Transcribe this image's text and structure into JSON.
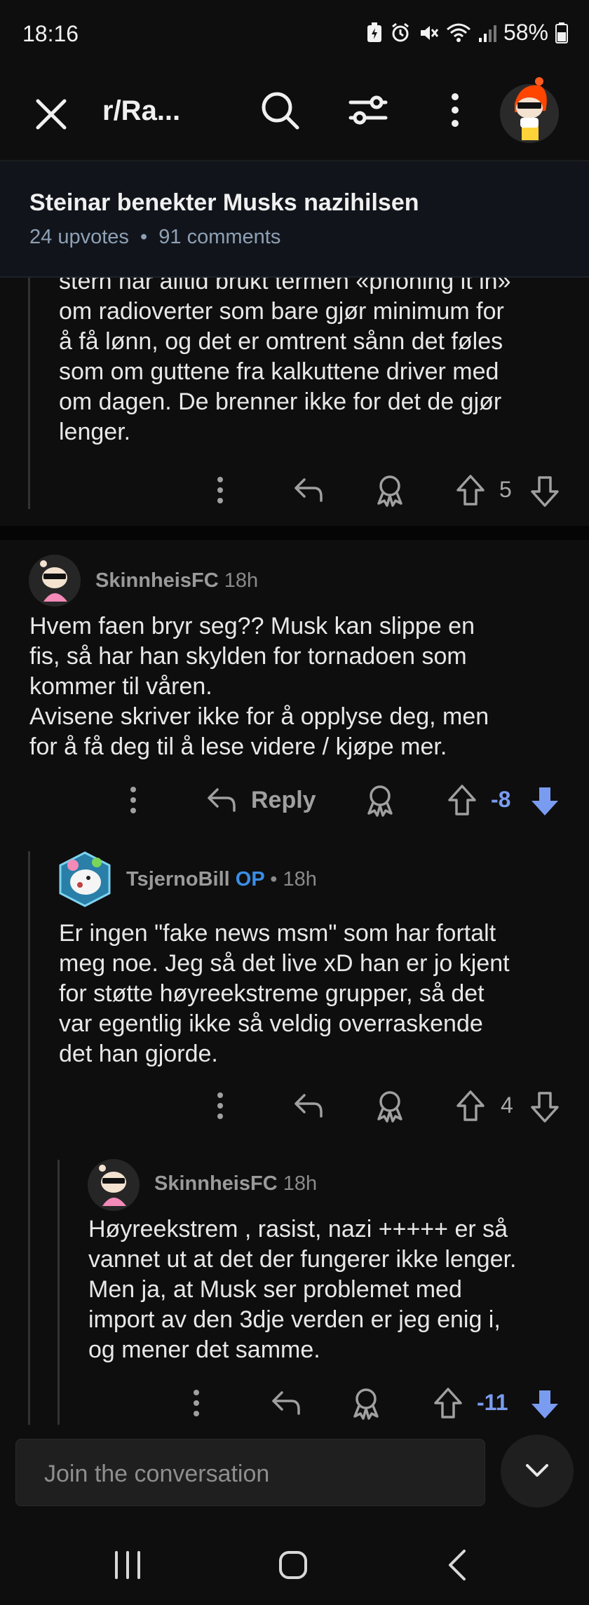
{
  "status": {
    "time": "18:16",
    "battery": "58%"
  },
  "header": {
    "title": "r/Ra..."
  },
  "post": {
    "title": "Steinar benekter Musks nazihilsen",
    "upvotes": "24 upvotes",
    "comments": "91 comments"
  },
  "comments": [
    {
      "lines": [
        "stern har alltid brukt termen «phoning it in»",
        "om radioverter som bare gjør minimum for",
        "å få lønn, og det er omtrent sånn det føles",
        "som om guttene fra kalkuttene driver med",
        "om dagen. De brenner ikke for det de gjør",
        "lenger."
      ],
      "score": "5"
    },
    {
      "author": "SkinnheisFC",
      "age": "18h",
      "lines": [
        "Hvem faen bryr seg?? Musk kan slippe en",
        "fis, så har han skylden for tornadoen som",
        "kommer til våren.",
        "Avisene skriver ikke for å opplyse deg, men",
        "for å få deg til å lese videre / kjøpe mer."
      ],
      "reply_label": "Reply",
      "score": "-8"
    },
    {
      "author": "TsjernoBill",
      "op": "OP",
      "age": "• 18h",
      "lines": [
        "Er ingen \"fake news msm\" som har fortalt",
        "meg noe. Jeg så det live xD han er jo kjent",
        "for støtte høyreekstreme grupper, så det",
        "var egentlig ikke så veldig overraskende",
        "det han gjorde."
      ],
      "score": "4"
    },
    {
      "author": "SkinnheisFC",
      "age": "18h",
      "lines": [
        "Høyreekstrem , rasist, nazi +++++ er så",
        "vannet ut at det der fungerer ikke lenger.",
        "Men ja, at Musk ser problemet med",
        "import av den 3dje verden er jeg enig i,",
        "og mener det samme."
      ],
      "score": "-11"
    }
  ],
  "composer": {
    "placeholder": "Join the conversation"
  },
  "colors": {
    "downvote_active": "#7a9cf0",
    "op_badge": "#3a8ee6",
    "background": "#0e0e0e"
  }
}
